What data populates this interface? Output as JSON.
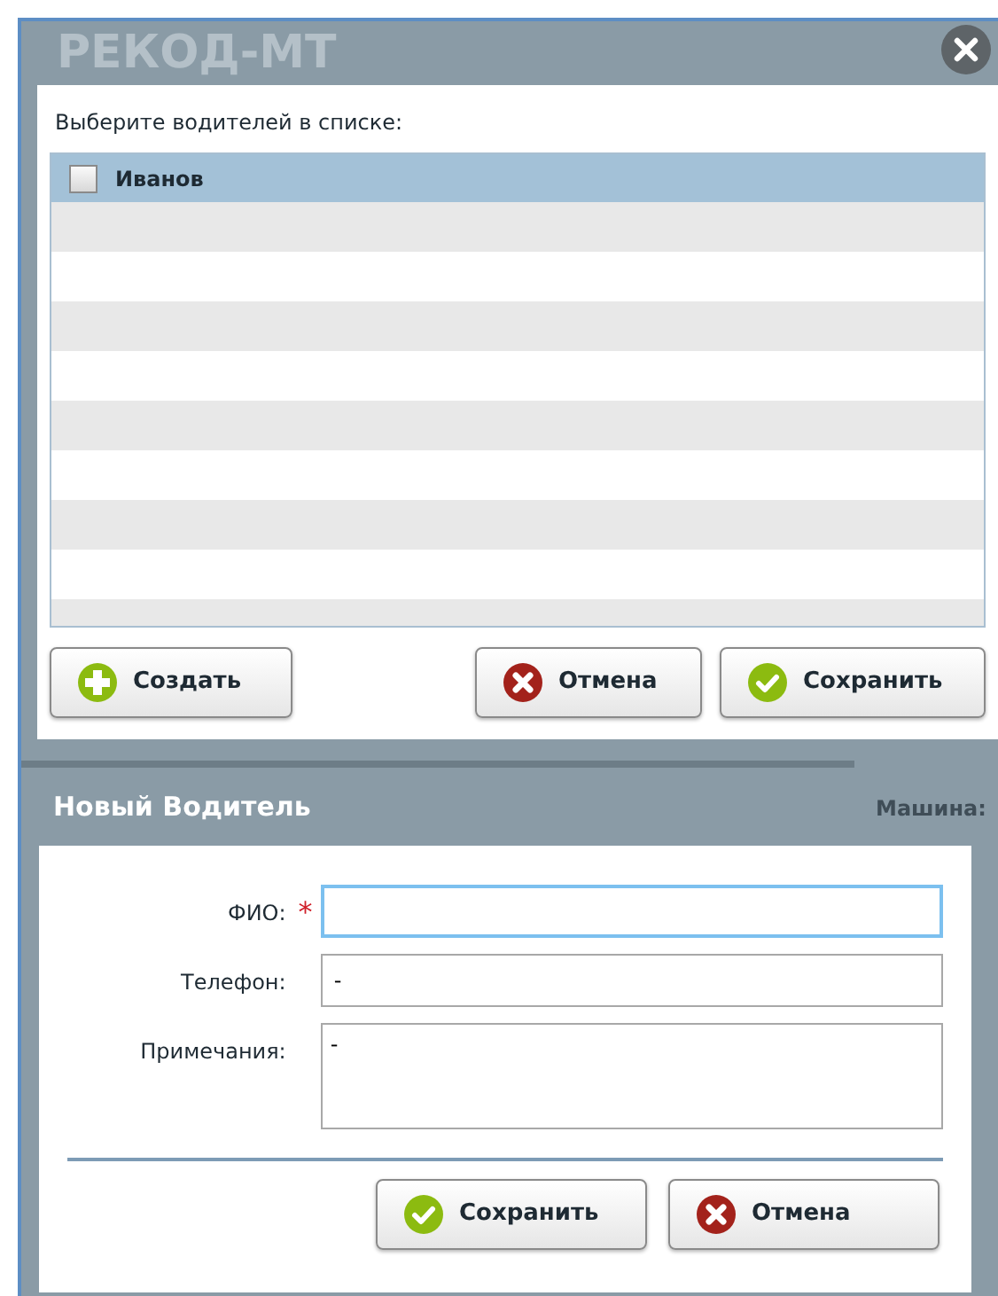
{
  "background": {
    "logo": "РЕКОД-МТ",
    "label": "Машина:"
  },
  "select_dialog": {
    "prompt": "Выберите водителей в списке:",
    "drivers": [
      {
        "name": "Иванов",
        "checked": false,
        "selected": true
      }
    ],
    "buttons": [
      {
        "kind": "create",
        "label": "Создать"
      },
      {
        "kind": "cancel",
        "label": "Отмена"
      },
      {
        "kind": "save",
        "label": "Сохранить"
      }
    ]
  },
  "new_driver_dialog": {
    "title": "Новый Водитель",
    "fields": [
      {
        "kind": "line",
        "label": "ФИО:",
        "required_mark": "*",
        "focused": true
      },
      {
        "kind": "line",
        "label": "Телефон:",
        "value": "-",
        "focused": false
      },
      {
        "kind": "area",
        "label": "Примечания:",
        "value": "-",
        "focused": false
      }
    ],
    "buttons": [
      {
        "kind": "save",
        "label": "Сохранить"
      },
      {
        "kind": "cancel",
        "label": "Отмена"
      }
    ]
  }
}
